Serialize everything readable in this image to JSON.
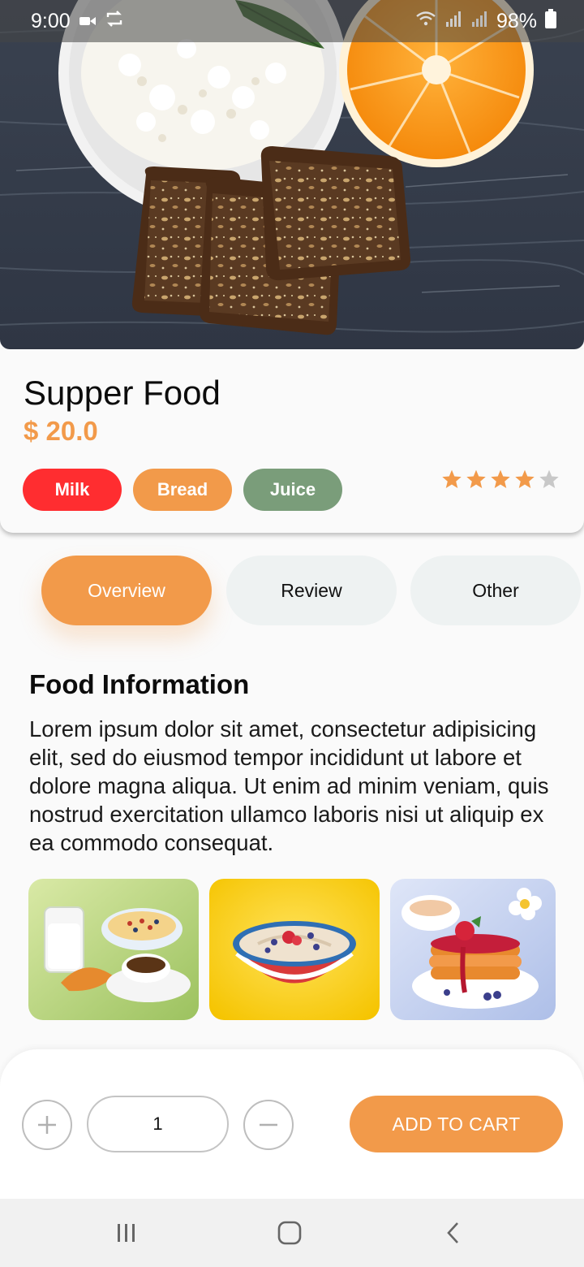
{
  "status_bar": {
    "time": "9:00",
    "battery": "98%",
    "icons": [
      "video-camera-icon",
      "sync-icon",
      "wifi-icon",
      "signal-icon",
      "signal-icon",
      "battery-icon"
    ]
  },
  "product": {
    "title": "Supper Food",
    "price": "$ 20.0",
    "rating": 4,
    "rating_max": 5,
    "tags": [
      {
        "label": "Milk",
        "color": "#ff2d30"
      },
      {
        "label": "Bread",
        "color": "#f29a4a"
      },
      {
        "label": "Juice",
        "color": "#7a9d7a"
      }
    ]
  },
  "tabs": [
    {
      "label": "Overview",
      "active": true
    },
    {
      "label": "Review",
      "active": false
    },
    {
      "label": "Other",
      "active": false
    }
  ],
  "info": {
    "title": "Food Information",
    "description": "Lorem ipsum dolor sit amet, consectetur adipisicing elit, sed do eiusmod tempor incididunt ut labore et dolore magna aliqua. Ut enim ad minim veniam, quis nostrud exercitation ullamco laboris nisi ut aliquip ex ea commodo consequat."
  },
  "gallery": [
    {
      "name": "breakfast-milk-croissant-image"
    },
    {
      "name": "porridge-bowl-image"
    },
    {
      "name": "pancakes-image"
    }
  ],
  "cart": {
    "quantity": "1",
    "add_label": "ADD TO CART"
  },
  "colors": {
    "accent": "#f29a4a",
    "star_empty": "#c8c8c8"
  },
  "nav": [
    "recent-apps-icon",
    "home-icon",
    "back-icon"
  ]
}
